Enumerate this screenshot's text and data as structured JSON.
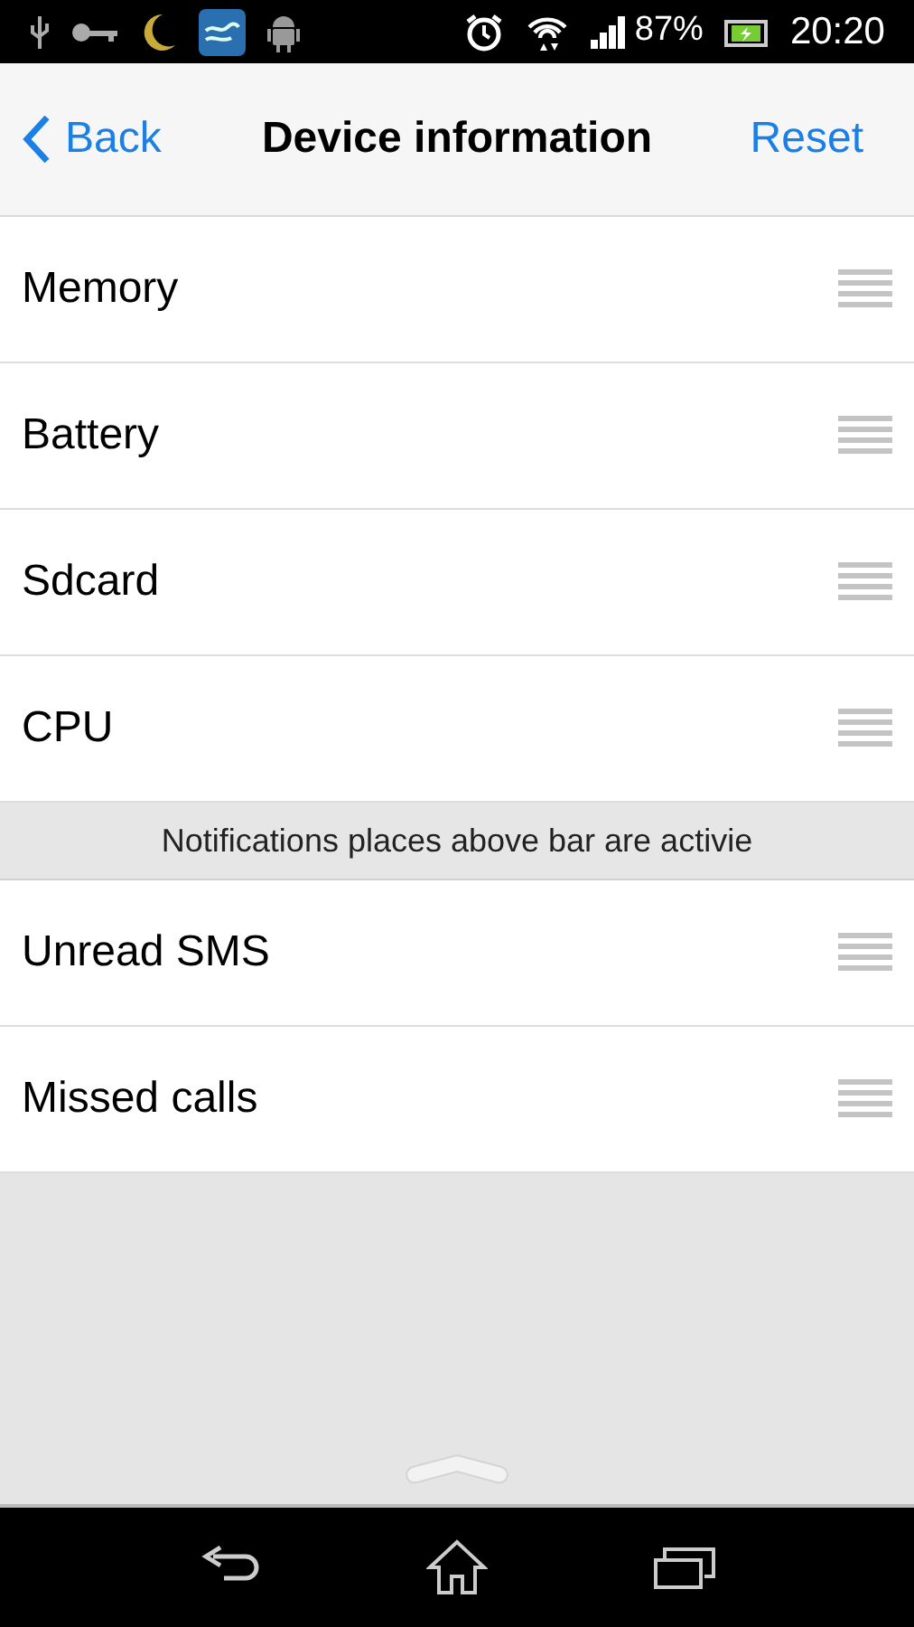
{
  "status_bar": {
    "battery": "87%",
    "time": "20:20"
  },
  "header": {
    "back": "Back",
    "title": "Device information",
    "action": "Reset"
  },
  "list": [
    {
      "kind": "row",
      "label": "Memory"
    },
    {
      "kind": "row",
      "label": "Battery"
    },
    {
      "kind": "row",
      "label": "Sdcard"
    },
    {
      "kind": "row",
      "label": "CPU"
    },
    {
      "kind": "section",
      "label": "Notifications places above bar are activie"
    },
    {
      "kind": "row",
      "label": "Unread SMS"
    },
    {
      "kind": "row",
      "label": "Missed calls"
    }
  ]
}
